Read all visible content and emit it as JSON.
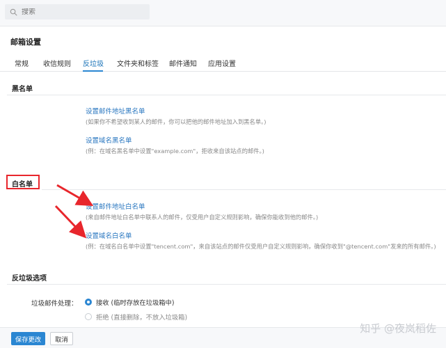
{
  "search": {
    "placeholder": "搜索",
    "icon": "search-icon"
  },
  "panel": {
    "title": "邮箱设置"
  },
  "tabs": [
    {
      "label": "常规"
    },
    {
      "label": "收信规则"
    },
    {
      "label": "反垃圾",
      "active": true
    },
    {
      "label": "文件夹和标签"
    },
    {
      "label": "邮件通知"
    },
    {
      "label": "应用设置"
    }
  ],
  "blacklist": {
    "heading": "黑名单",
    "address_link": "设置邮件地址黑名单",
    "address_hint": "(如果你不希望收到某人的邮件，你可以把他的邮件地址加入到黑名单。)",
    "domain_link": "设置域名黑名单",
    "domain_hint": "(例：在域名黑名单中设置\"example.com\"，拒收来自该站点的邮件。)"
  },
  "whitelist": {
    "heading": "白名单",
    "address_link": "设置邮件地址白名单",
    "address_hint": "(来自邮件地址白名单中联系人的邮件，仅受用户自定义规则影响，确保你能收到他的邮件。)",
    "domain_link": "设置域名白名单",
    "domain_hint": "(例：在域名白名单中设置\"tencent.com\"，来自该站点的邮件仅受用户自定义规则影响，确保你收到\"@tencent.com\"发来的所有邮件。)"
  },
  "spam_options": {
    "heading": "反垃圾选项",
    "label": "垃圾邮件处理：",
    "options": [
      {
        "label": "接收 (临时存放在垃圾箱中)",
        "selected": true
      },
      {
        "label": "拒绝 (直接删除，不放入垃圾箱)",
        "selected": false
      }
    ]
  },
  "footer": {
    "save_label": "保存更改",
    "cancel_label": "取消"
  },
  "watermark": "知乎 @夜岚稻佐",
  "colors": {
    "accent": "#2a86d2",
    "link": "#2a77c0",
    "highlight": "#e8262c"
  }
}
